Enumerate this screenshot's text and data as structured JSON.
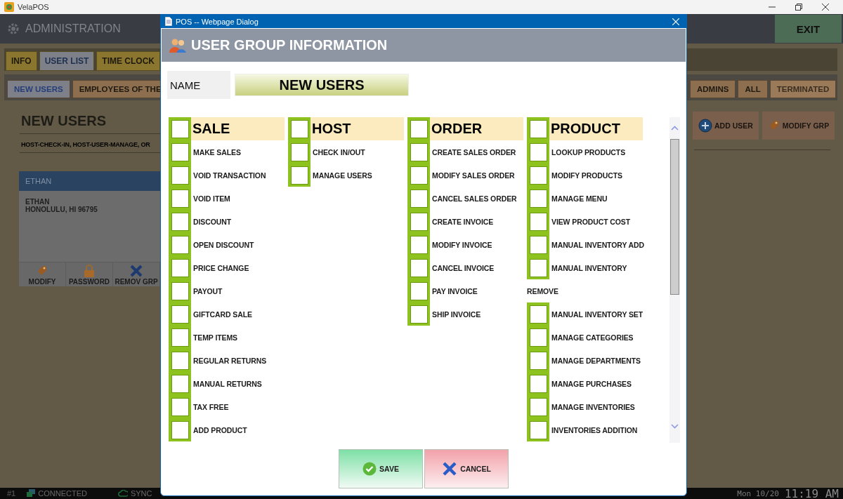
{
  "app_window": {
    "title": "VelaPOS"
  },
  "header": {
    "title": "ADMINISTRATION",
    "exit_button": "EXIT"
  },
  "tabs": [
    {
      "label": "INFO",
      "selected": false
    },
    {
      "label": "USER LIST",
      "selected": true
    },
    {
      "label": "TIME CLOCK",
      "selected": false
    }
  ],
  "group_tabs_left": [
    {
      "label": "NEW USERS",
      "selected": true,
      "disabled": false
    },
    {
      "label": "EMPLOYEES OF THE",
      "selected": false,
      "disabled": false
    }
  ],
  "group_tabs_right": [
    {
      "label": "ADMINS",
      "selected": false,
      "disabled": false
    },
    {
      "label": "ALL",
      "selected": false,
      "disabled": false
    },
    {
      "label": "TERMINATED",
      "selected": false,
      "disabled": true
    }
  ],
  "group": {
    "title": "NEW USERS",
    "permissions": "HOST-CHECK-IN, HOST-USER-MANAGE, OR"
  },
  "group_actions": [
    {
      "kind": "add",
      "label": "ADD USER"
    },
    {
      "kind": "modify",
      "label": "MODIFY GRP"
    }
  ],
  "user_card": {
    "header": "ETHAN",
    "lines": [
      "ETHAN",
      "HONOLULU, HI 96795"
    ],
    "actions": [
      {
        "kind": "modify",
        "label": "MODIFY"
      },
      {
        "kind": "password",
        "label": "PASSWORD"
      },
      {
        "kind": "remove",
        "label": "REMOV GRP"
      }
    ]
  },
  "status_bar": {
    "terminal": "#1",
    "connection": "CONNECTED",
    "sync": "SYNC",
    "date": "Mon 10/20",
    "time": "11:19 AM"
  },
  "dialog": {
    "title": "POS -- Webpage Dialog",
    "heading": "USER GROUP INFORMATION",
    "name_label": "NAME",
    "name_value": "NEW USERS",
    "sections": [
      {
        "title": "SALE",
        "checked": false,
        "items": [
          {
            "kind": "checkbox",
            "label": "MAKE SALES",
            "checked": false
          },
          {
            "kind": "checkbox",
            "label": "VOID TRANSACTION",
            "checked": false
          },
          {
            "kind": "checkbox",
            "label": "VOID ITEM",
            "checked": false
          },
          {
            "kind": "checkbox",
            "label": "DISCOUNT",
            "checked": false
          },
          {
            "kind": "checkbox",
            "label": "OPEN DISCOUNT",
            "checked": false
          },
          {
            "kind": "checkbox",
            "label": "PRICE CHANGE",
            "checked": false
          },
          {
            "kind": "checkbox",
            "label": "PAYOUT",
            "checked": false
          },
          {
            "kind": "checkbox",
            "label": "GIFTCARD SALE",
            "checked": false
          },
          {
            "kind": "checkbox",
            "label": "TEMP ITEMS",
            "checked": false
          },
          {
            "kind": "checkbox",
            "label": "REGULAR RETURNS",
            "checked": false
          },
          {
            "kind": "checkbox",
            "label": "MANUAL RETURNS",
            "checked": false
          },
          {
            "kind": "checkbox",
            "label": "TAX FREE",
            "checked": false
          },
          {
            "kind": "checkbox",
            "label": "ADD PRODUCT",
            "checked": false
          }
        ]
      },
      {
        "title": "HOST",
        "checked": false,
        "items": [
          {
            "kind": "checkbox",
            "label": "CHECK IN/OUT",
            "checked": false
          },
          {
            "kind": "checkbox",
            "label": "MANAGE USERS",
            "checked": false
          }
        ]
      },
      {
        "title": "ORDER",
        "checked": false,
        "items": [
          {
            "kind": "checkbox",
            "label": "CREATE SALES ORDER",
            "checked": false
          },
          {
            "kind": "checkbox",
            "label": "MODIFY SALES ORDER",
            "checked": false
          },
          {
            "kind": "checkbox",
            "label": "CANCEL SALES ORDER",
            "checked": false
          },
          {
            "kind": "checkbox",
            "label": "CREATE INVOICE",
            "checked": false
          },
          {
            "kind": "checkbox",
            "label": "MODIFY INVOICE",
            "checked": false
          },
          {
            "kind": "checkbox",
            "label": "CANCEL INVOICE",
            "checked": false
          },
          {
            "kind": "checkbox",
            "label": "PAY INVOICE",
            "checked": false
          },
          {
            "kind": "checkbox",
            "label": "SHIP INVOICE",
            "checked": false
          }
        ]
      },
      {
        "title": "PRODUCT",
        "checked": false,
        "items": [
          {
            "kind": "checkbox",
            "label": "LOOKUP PRODUCTS",
            "checked": false
          },
          {
            "kind": "checkbox",
            "label": "MODIFY PRODUCTS",
            "checked": false
          },
          {
            "kind": "checkbox",
            "label": "MANAGE MENU",
            "checked": false
          },
          {
            "kind": "checkbox",
            "label": "VIEW PRODUCT COST",
            "checked": false
          },
          {
            "kind": "checkbox",
            "label": "MANUAL INVENTORY ADD",
            "checked": false
          },
          {
            "kind": "checkbox",
            "label": "MANUAL INVENTORY",
            "checked": false
          },
          {
            "kind": "text",
            "label": "REMOVE"
          },
          {
            "kind": "checkbox",
            "label": "MANUAL INVENTORY SET",
            "checked": false
          },
          {
            "kind": "checkbox",
            "label": "MANAGE CATEGORIES",
            "checked": false
          },
          {
            "kind": "checkbox",
            "label": "MANAGE DEPARTMENTS",
            "checked": false
          },
          {
            "kind": "checkbox",
            "label": "MANAGE PURCHASES",
            "checked": false
          },
          {
            "kind": "checkbox",
            "label": "MANAGE INVENTORIES",
            "checked": false
          },
          {
            "kind": "checkbox",
            "label": "INVENTORIES ADDITION",
            "checked": false
          }
        ]
      }
    ],
    "buttons": [
      {
        "kind": "save",
        "label": "SAVE"
      },
      {
        "kind": "cancel",
        "label": "CANCEL"
      }
    ]
  }
}
